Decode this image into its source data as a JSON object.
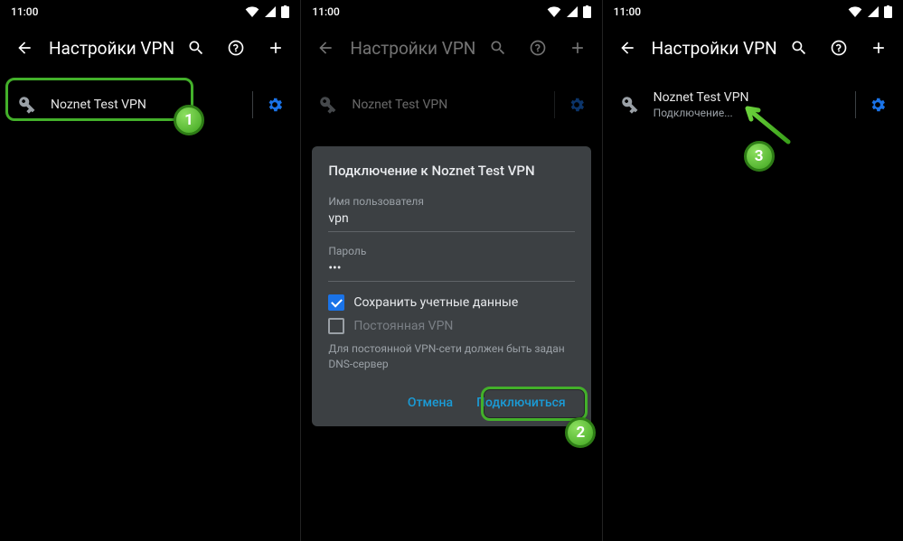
{
  "status": {
    "time": "11:00"
  },
  "appbar": {
    "title": "Настройки VPN"
  },
  "vpn": {
    "name": "Noznet Test VPN",
    "connecting": "Подключение..."
  },
  "dialog": {
    "title": "Подключение к Noznet Test VPN",
    "username_label": "Имя пользователя",
    "username_value": "vpn",
    "password_label": "Пароль",
    "password_value": "•••",
    "save_label": "Сохранить учетные данные",
    "perm_label": "Постоянная VPN",
    "dns_note": "Для постоянной VPN-сети должен быть задан DNS-сервер",
    "cancel": "Отмена",
    "connect": "Подключиться"
  },
  "markers": {
    "m1": "1",
    "m2": "2",
    "m3": "3"
  }
}
